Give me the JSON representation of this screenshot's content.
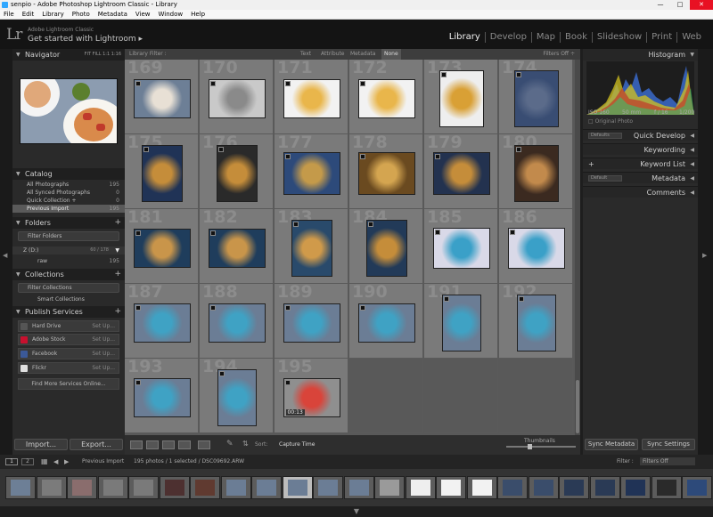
{
  "window": {
    "title": "senpio - Adobe Photoshop Lightroom Classic - Library"
  },
  "menu": [
    "File",
    "Edit",
    "Library",
    "Photo",
    "Metadata",
    "View",
    "Window",
    "Help"
  ],
  "identity": {
    "small": "Adobe Lightroom Classic",
    "big": "Get started with Lightroom"
  },
  "modules": [
    "Library",
    "Develop",
    "Map",
    "Book",
    "Slideshow",
    "Print",
    "Web"
  ],
  "navigator": {
    "title": "Navigator",
    "zoom_options": "FIT   FILL   1:1   1:16"
  },
  "catalog": {
    "title": "Catalog",
    "items": [
      {
        "label": "All Photographs",
        "count": "195"
      },
      {
        "label": "All Synced Photographs",
        "count": "0"
      },
      {
        "label": "Quick Collection +",
        "count": "0"
      },
      {
        "label": "Previous Import",
        "count": "195"
      }
    ]
  },
  "folders": {
    "title": "Folders",
    "filter": "Filter Folders",
    "drive": "Z (D:)",
    "drive_space": "60 / 178",
    "folder": "raw",
    "folder_count": "195"
  },
  "collections": {
    "title": "Collections",
    "filter": "Filter Collections",
    "smart": "Smart Collections"
  },
  "publish": {
    "title": "Publish Services",
    "services": [
      {
        "label": "Hard Drive",
        "action": "Set Up...",
        "color": "#555555"
      },
      {
        "label": "Adobe Stock",
        "action": "Set Up...",
        "color": "#c8102e"
      },
      {
        "label": "Facebook",
        "action": "Set Up...",
        "color": "#3b5998"
      },
      {
        "label": "Flickr",
        "action": "Set Up...",
        "color": "#e0e0e0"
      }
    ],
    "find_more": "Find More Services Online..."
  },
  "left_buttons": {
    "import": "Import...",
    "export": "Export..."
  },
  "filter_bar": {
    "label": "Library Filter :",
    "tabs": [
      "Text",
      "Attribute",
      "Metadata",
      "None"
    ],
    "state": "Filters Off ÷"
  },
  "grid": {
    "rows": [
      [
        "169",
        "170",
        "171",
        "172",
        "173",
        "174"
      ],
      [
        "175",
        "176",
        "177",
        "178",
        "179",
        "180"
      ],
      [
        "181",
        "182",
        "183",
        "184",
        "185",
        "186"
      ],
      [
        "187",
        "188",
        "189",
        "190",
        "191",
        "192"
      ],
      [
        "193",
        "194",
        "195",
        "",
        "",
        ""
      ]
    ],
    "video_duration": "00:13"
  },
  "toolbar": {
    "sort_label": "Sort:",
    "sort_value": "Capture Time",
    "thumbnails": "Thumbnails"
  },
  "histogram": {
    "title": "Histogram",
    "iso": "ISO 160",
    "focal": "50 mm",
    "aperture": "f / 16",
    "shutter": "1/200",
    "original": "Original Photo"
  },
  "right_panels": [
    {
      "label": "Quick Develop",
      "preset": "Defaults"
    },
    {
      "label": "Keywording",
      "preset": ""
    },
    {
      "label": "Keyword List",
      "preset": ""
    },
    {
      "label": "Metadata",
      "preset": "Default"
    },
    {
      "label": "Comments",
      "preset": ""
    }
  ],
  "right_buttons": {
    "sync_meta": "Sync Metadata",
    "sync_settings": "Sync Settings"
  },
  "filmstrip_bar": {
    "page1": "1",
    "page2": "2",
    "source": "Previous Import",
    "info": "195 photos / 1 selected / DSC09692.ARW",
    "filter_label": "Filter :",
    "filter_value": "Filters Off"
  },
  "colors": {
    "accent_selected": "#a6a6a6",
    "panel": "#2a2a2a",
    "grid_bg": "#595959"
  }
}
